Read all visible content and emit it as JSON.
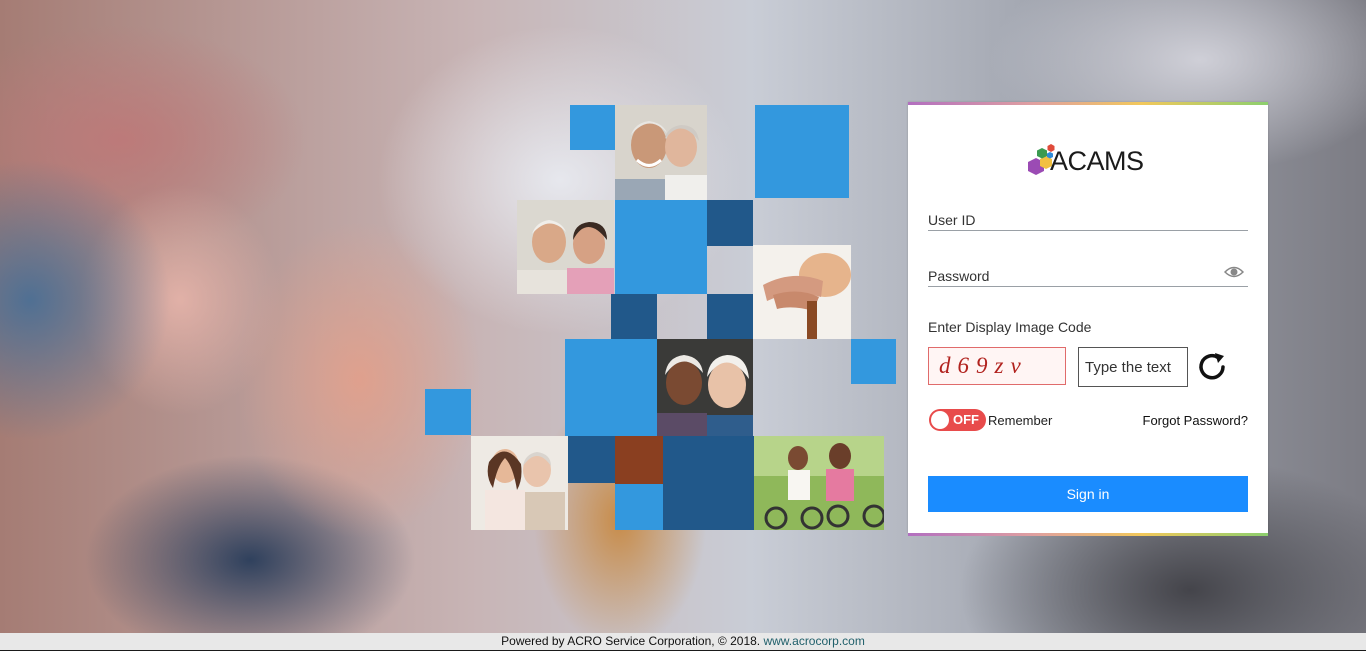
{
  "brand": {
    "logo_text": "ACAMS"
  },
  "login": {
    "user_id_label": "User ID",
    "password_label": "Password",
    "captcha_label": "Enter Display Image Code",
    "captcha_code": "d69zv",
    "captcha_placeholder": "Type the text",
    "remember_toggle_state": "OFF",
    "remember_label": "Remember",
    "forgot_password": "Forgot Password?",
    "sign_in": "Sign in"
  },
  "footer": {
    "text": "Powered by ACRO Service Corporation, © 2018.",
    "link_text": "www.acrocorp.com"
  },
  "colors": {
    "accent": "#1a8cff",
    "toggle_off": "#e84b4b",
    "tile_light": "#3398de",
    "tile_dark": "#21588a"
  }
}
